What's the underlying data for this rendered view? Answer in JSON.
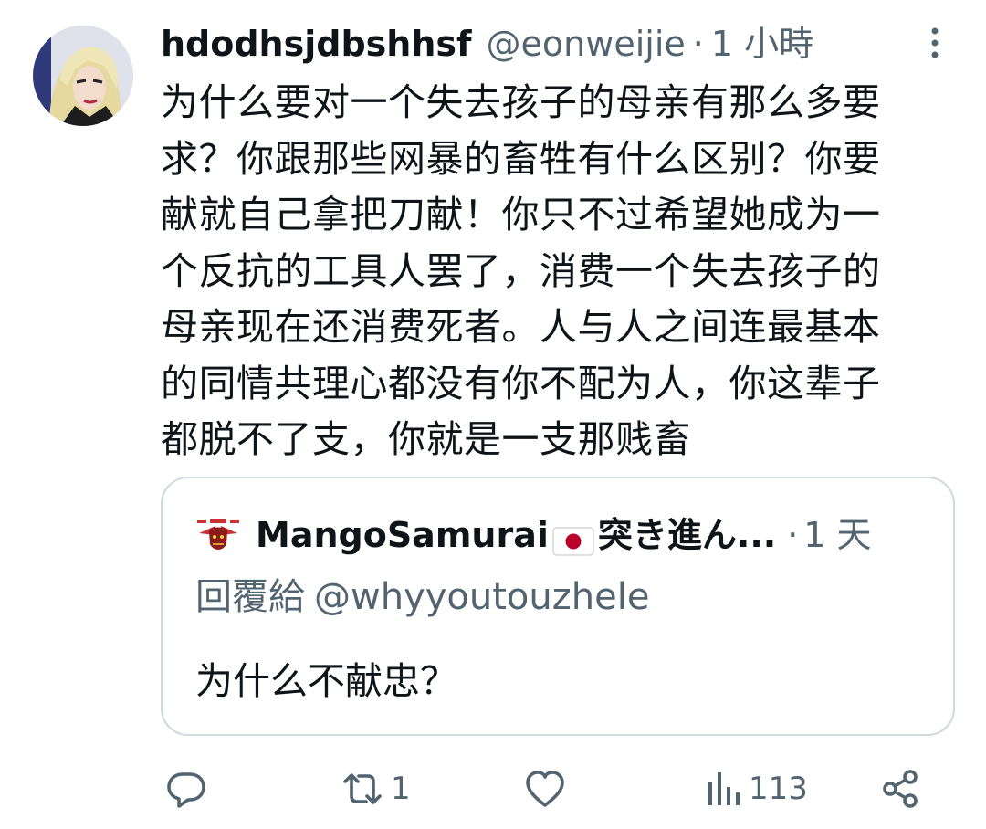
{
  "tweet": {
    "display_name": "hdodhsjdbshhsf",
    "handle": "@eonweijie",
    "separator": "·",
    "time": "1 小時",
    "text": "为什么要对一个失去孩子的母亲有那么多要\n求？你跟那些网暴的畜牲有什么区别？你要\n献就自己拿把刀献！你只不过希望她成为一\n个反抗的工具人罢了，消费一个失去孩子的\n母亲现在还消费死者。人与人之间连最基本\n的同情共理心都没有你不配为人，你这辈子\n都脱不了支，你就是一支那贱畜"
  },
  "quote": {
    "display_name": "MangoSamurai",
    "flag_icon": "japan-flag-emoji",
    "name_suffix": "突き進ん...",
    "separator": "·",
    "time": "1 天",
    "reply_label": "回覆給",
    "reply_handle": "@whyyoutouzhele",
    "text": "为什么不献忠？"
  },
  "actions": {
    "reply_icon": "reply-icon",
    "retweet_icon": "retweet-icon",
    "retweet_count": "1",
    "like_icon": "heart-icon",
    "views_icon": "views-chart-icon",
    "views_count": "113",
    "share_icon": "share-icon"
  },
  "colors": {
    "primary_text": "#0f1419",
    "secondary_text": "#536471",
    "card_border": "#cfd9de"
  }
}
